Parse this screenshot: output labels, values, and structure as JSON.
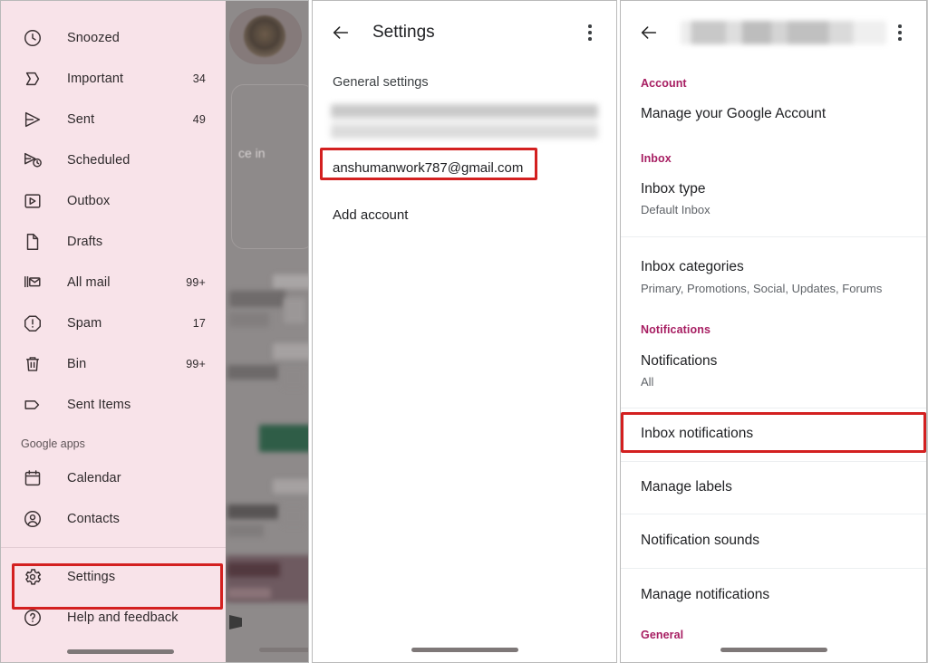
{
  "panel_drawer": {
    "name": "gmail-navigation-drawer",
    "background_color": "#f8e3e9",
    "items": [
      {
        "label": "Snoozed",
        "count": "",
        "icon": "clock-icon"
      },
      {
        "label": "Important",
        "count": "34",
        "icon": "important-marker-icon"
      },
      {
        "label": "Sent",
        "count": "49",
        "icon": "send-icon"
      },
      {
        "label": "Scheduled",
        "count": "",
        "icon": "scheduled-send-icon"
      },
      {
        "label": "Outbox",
        "count": "",
        "icon": "outbox-icon"
      },
      {
        "label": "Drafts",
        "count": "",
        "icon": "draft-document-icon"
      },
      {
        "label": "All mail",
        "count": "99+",
        "icon": "all-mail-icon"
      },
      {
        "label": "Spam",
        "count": "17",
        "icon": "spam-octagon-icon"
      },
      {
        "label": "Bin",
        "count": "99+",
        "icon": "trash-icon"
      },
      {
        "label": "Sent Items",
        "count": "",
        "icon": "label-tag-icon"
      }
    ],
    "section_label": "Google apps",
    "apps": [
      {
        "label": "Calendar",
        "icon": "calendar-icon"
      },
      {
        "label": "Contacts",
        "icon": "contacts-icon"
      }
    ],
    "footer": [
      {
        "label": "Settings",
        "icon": "gear-icon"
      },
      {
        "label": "Help and feedback",
        "icon": "help-circle-icon"
      }
    ],
    "background_text": "ce in"
  },
  "panel_settings": {
    "name": "settings-screen",
    "back_icon": "back-arrow-icon",
    "title": "Settings",
    "overflow_icon": "overflow-menu-icon",
    "general_settings_label": "General settings",
    "account_email": "anshumanwork787@gmail.com",
    "add_account_label": "Add account"
  },
  "panel_account_settings": {
    "name": "account-settings-screen",
    "back_icon": "back-arrow-icon",
    "title_redacted": true,
    "overflow_icon": "overflow-menu-icon",
    "groups": [
      {
        "header": "Account",
        "rows": [
          {
            "title": "Manage your Google Account",
            "subtitle": ""
          }
        ]
      },
      {
        "header": "Inbox",
        "rows": [
          {
            "title": "Inbox type",
            "subtitle": "Default Inbox"
          },
          {
            "title": "Inbox categories",
            "subtitle": "Primary, Promotions, Social, Updates, Forums"
          }
        ]
      },
      {
        "header": "Notifications",
        "rows": [
          {
            "title": "Notifications",
            "subtitle": "All"
          },
          {
            "title": "Inbox notifications",
            "subtitle": ""
          },
          {
            "title": "Manage labels",
            "subtitle": ""
          },
          {
            "title": "Notification sounds",
            "subtitle": ""
          },
          {
            "title": "Manage notifications",
            "subtitle": ""
          }
        ]
      },
      {
        "header": "General",
        "rows": []
      }
    ]
  },
  "annotations": {
    "color": "#d32020",
    "boxes": [
      {
        "target": "settings-drawer-item"
      },
      {
        "target": "account-email-row"
      },
      {
        "target": "inbox-notifications-row"
      }
    ]
  },
  "colors": {
    "drawer_pink": "#f8e3e9",
    "section_header_magenta": "#a71e62",
    "primary_text": "#202124",
    "secondary_text": "#5f6368",
    "highlight_red": "#d32020"
  }
}
